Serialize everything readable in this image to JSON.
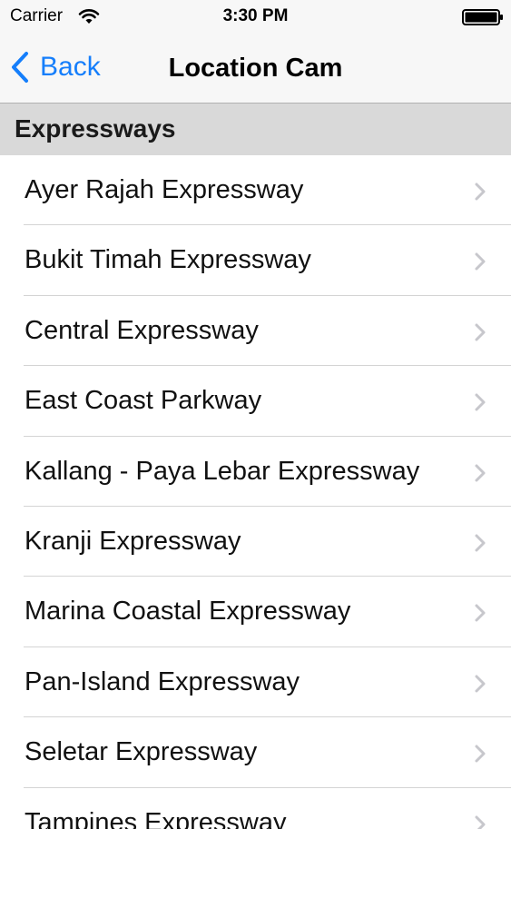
{
  "status_bar": {
    "carrier": "Carrier",
    "time": "3:30 PM",
    "icons": [
      "wifi-icon",
      "battery-icon"
    ]
  },
  "nav": {
    "back_label": "Back",
    "title": "Location Cam",
    "accent_color": "#157efb"
  },
  "section": {
    "title": "Expressways"
  },
  "items": [
    {
      "label": "Ayer Rajah Expressway"
    },
    {
      "label": "Bukit Timah Expressway"
    },
    {
      "label": "Central Expressway"
    },
    {
      "label": "East Coast Parkway"
    },
    {
      "label": "Kallang - Paya Lebar Expressway"
    },
    {
      "label": "Kranji Expressway"
    },
    {
      "label": "Marina Coastal Expressway"
    },
    {
      "label": "Pan-Island Expressway"
    },
    {
      "label": "Seletar Expressway"
    },
    {
      "label": "Tampines Expressway"
    }
  ]
}
